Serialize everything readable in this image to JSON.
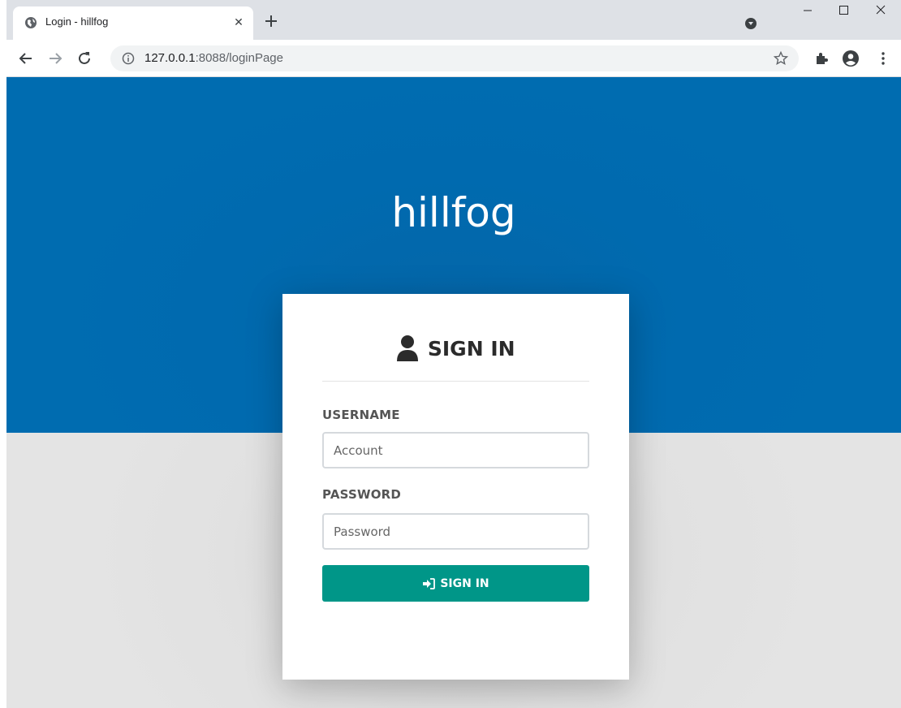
{
  "browser": {
    "tab": {
      "title": "Login - hillfog",
      "favicon": "globe-icon"
    },
    "address": {
      "host": "127.0.0.1",
      "path": ":8088/loginPage"
    }
  },
  "page": {
    "brand": "hillfog",
    "card": {
      "title": "SIGN IN",
      "username_label": "USERNAME",
      "username_placeholder": "Account",
      "password_label": "PASSWORD",
      "password_placeholder": "Password",
      "submit_label": "SIGN IN"
    }
  },
  "colors": {
    "hero": "#006cb0",
    "accent_button": "#009688",
    "background": "#e4e4e4"
  }
}
